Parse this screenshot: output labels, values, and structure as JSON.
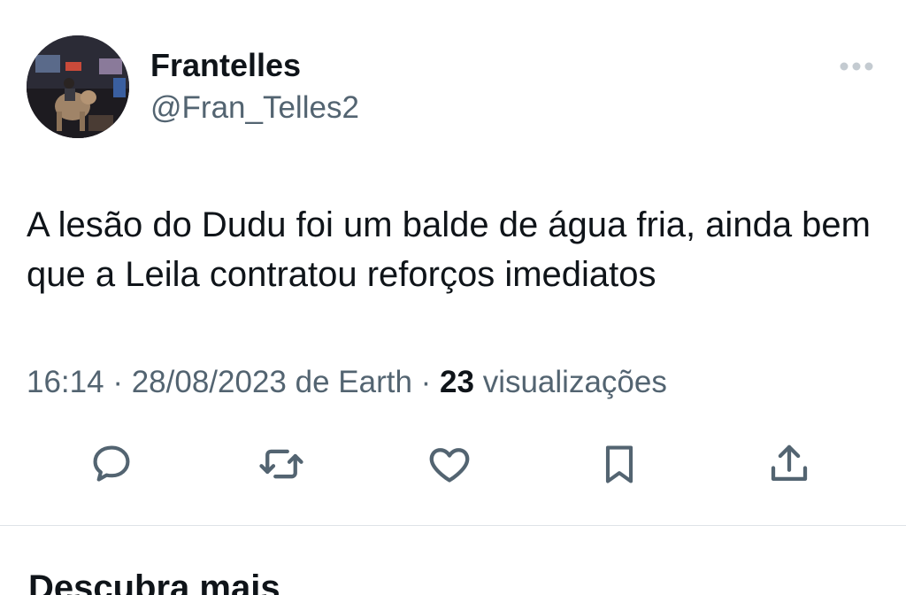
{
  "tweet": {
    "author": {
      "display_name": "Frantelles",
      "handle": "@Fran_Telles2",
      "avatar_icon": "profile-photo"
    },
    "text": "A lesão do Dudu foi um balde de água fria, ainda bem que a Leila contratou reforços imediatos",
    "meta": {
      "time": "16:14",
      "separator": " · ",
      "date": "28/08/2023",
      "source": " de Earth",
      "views_count": "23",
      "views_label": " visualizações"
    },
    "actions": [
      {
        "name": "reply",
        "icon": "speech-bubble-icon"
      },
      {
        "name": "retweet",
        "icon": "retweet-icon"
      },
      {
        "name": "like",
        "icon": "heart-icon"
      },
      {
        "name": "bookmark",
        "icon": "bookmark-icon"
      },
      {
        "name": "share",
        "icon": "share-icon"
      }
    ]
  },
  "section": {
    "title": "Descubra mais"
  },
  "colors": {
    "text_primary": "#0f1419",
    "text_secondary": "#536471",
    "divider": "#dfe3e7",
    "background": "#ffffff"
  }
}
